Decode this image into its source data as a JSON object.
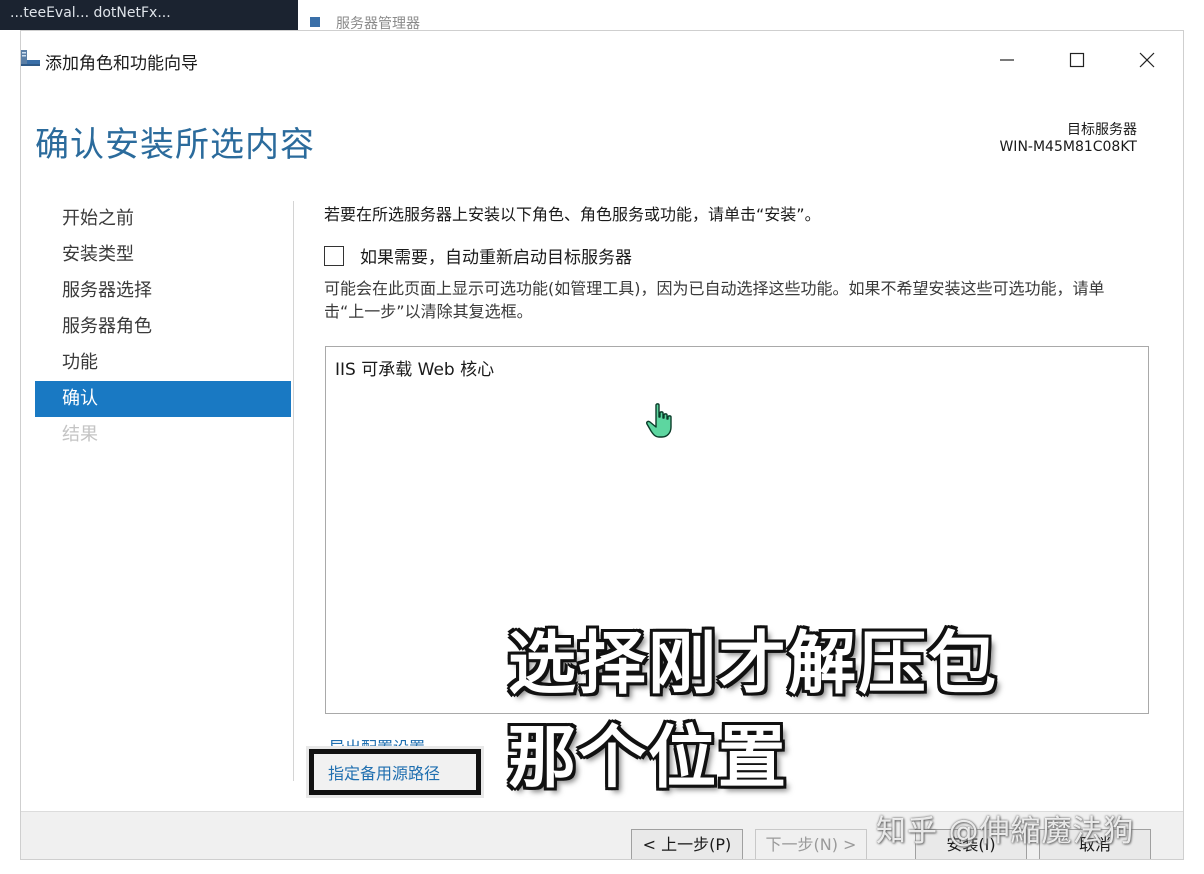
{
  "background": {
    "taskbar_text": "...teeEval... dotNetFx...",
    "app_title": "服务器管理器"
  },
  "window": {
    "title": "添加角色和功能向导",
    "icon": "server-wizard-icon"
  },
  "header": {
    "page_title": "确认安装所选内容",
    "dest_label": "目标服务器",
    "dest_server": "WIN-M45M81C08KT"
  },
  "nav": {
    "items": [
      {
        "label": "开始之前",
        "state": "normal"
      },
      {
        "label": "安装类型",
        "state": "normal"
      },
      {
        "label": "服务器选择",
        "state": "normal"
      },
      {
        "label": "服务器角色",
        "state": "normal"
      },
      {
        "label": "功能",
        "state": "normal"
      },
      {
        "label": "确认",
        "state": "active"
      },
      {
        "label": "结果",
        "state": "disabled"
      }
    ],
    "active_color": "#1979c3"
  },
  "content": {
    "intro": "若要在所选服务器上安装以下角色、角色服务或功能，请单击“安装”。",
    "restart_checkbox": {
      "label": "如果需要，自动重新启动目标服务器",
      "checked": false
    },
    "note": "可能会在此页面上显示可选功能(如管理工具)，因为已自动选择这些功能。如果不希望安装这些可选功能，请单击“上一步”以清除其复选框。",
    "features": [
      "IIS 可承载 Web 核心"
    ],
    "export_link": "导出配置设置",
    "alt_source_link": "指定备用源路径"
  },
  "footer": {
    "prev": "< 上一步(P)",
    "next": "下一步(N) >",
    "install": "安装(I)",
    "cancel": "取消"
  },
  "overlay": {
    "caption_line1": "选择刚才解压包",
    "caption_line2": "那个位置",
    "watermark": "知乎 @伸縮魔法狗"
  },
  "colors": {
    "title_blue": "#2b6b9c",
    "link_blue": "#1f6fb0"
  }
}
